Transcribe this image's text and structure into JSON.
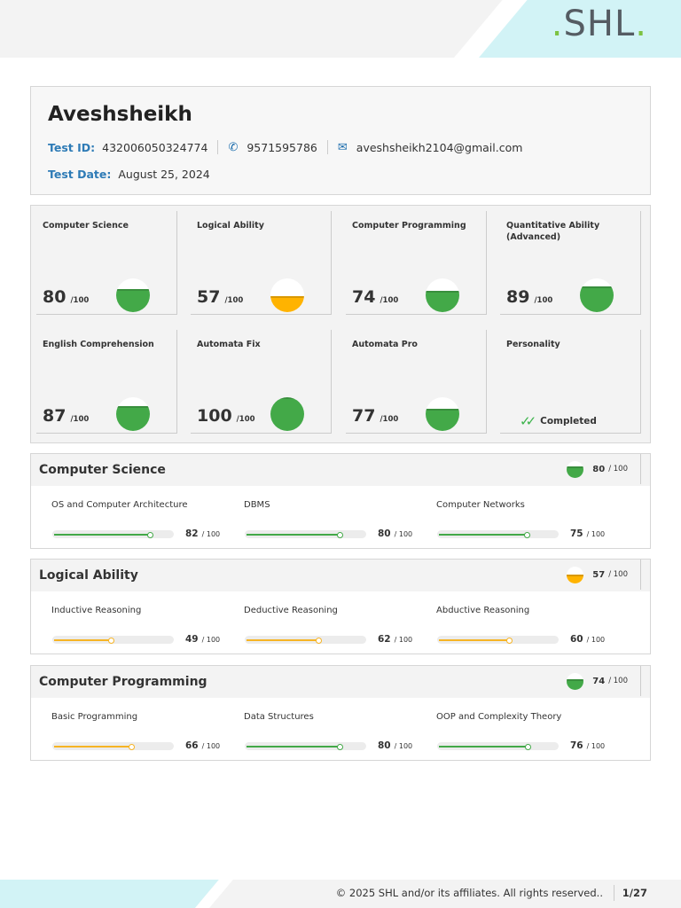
{
  "header": {
    "logo": "SHL"
  },
  "profile": {
    "name": "Aveshsheikh",
    "test_id_label": "Test ID:",
    "test_id": "432006050324774",
    "phone": "9571595786",
    "email": "aveshsheikh2104@gmail.com",
    "test_date_label": "Test Date:",
    "test_date": "August 25, 2024",
    "icons": {
      "phone": "phone-icon",
      "email": "envelope-icon"
    }
  },
  "score_cards": [
    {
      "title": "Computer Science",
      "score": 80,
      "max": "/100"
    },
    {
      "title": "Logical Ability",
      "score": 57,
      "max": "/100"
    },
    {
      "title": "Computer Programming",
      "score": 74,
      "max": "/100"
    },
    {
      "title": "Quantitative Ability (Advanced)",
      "score": 89,
      "max": "/100"
    },
    {
      "title": "English Comprehension",
      "score": 87,
      "max": "/100"
    },
    {
      "title": "Automata Fix",
      "score": 100,
      "max": "/100"
    },
    {
      "title": "Automata Pro",
      "score": 77,
      "max": "/100"
    },
    {
      "title": "Personality",
      "status": "Completed"
    }
  ],
  "sections": [
    {
      "title": "Computer Science",
      "score": 80,
      "max": "/ 100",
      "subs": [
        {
          "name": "OS and Computer Architecture",
          "score": 82,
          "max": "/ 100"
        },
        {
          "name": "DBMS",
          "score": 80,
          "max": "/ 100"
        },
        {
          "name": "Computer Networks",
          "score": 75,
          "max": "/ 100"
        }
      ]
    },
    {
      "title": "Logical Ability",
      "score": 57,
      "max": "/ 100",
      "subs": [
        {
          "name": "Inductive Reasoning",
          "score": 49,
          "max": "/ 100"
        },
        {
          "name": "Deductive Reasoning",
          "score": 62,
          "max": "/ 100"
        },
        {
          "name": "Abductive Reasoning",
          "score": 60,
          "max": "/ 100"
        }
      ]
    },
    {
      "title": "Computer Programming",
      "score": 74,
      "max": "/ 100",
      "subs": [
        {
          "name": "Basic Programming",
          "score": 66,
          "max": "/ 100"
        },
        {
          "name": "Data Structures",
          "score": 80,
          "max": "/ 100"
        },
        {
          "name": "OOP and Complexity Theory",
          "score": 76,
          "max": "/ 100"
        }
      ]
    }
  ],
  "colors": {
    "high": "#43a948",
    "mid": "#ffb300",
    "low_bar": "#f6b425",
    "accent": "#2e7bb6"
  },
  "footer": {
    "copyright": "© 2025 SHL and/or its affiliates. All rights reserved..",
    "page": "1/27"
  }
}
